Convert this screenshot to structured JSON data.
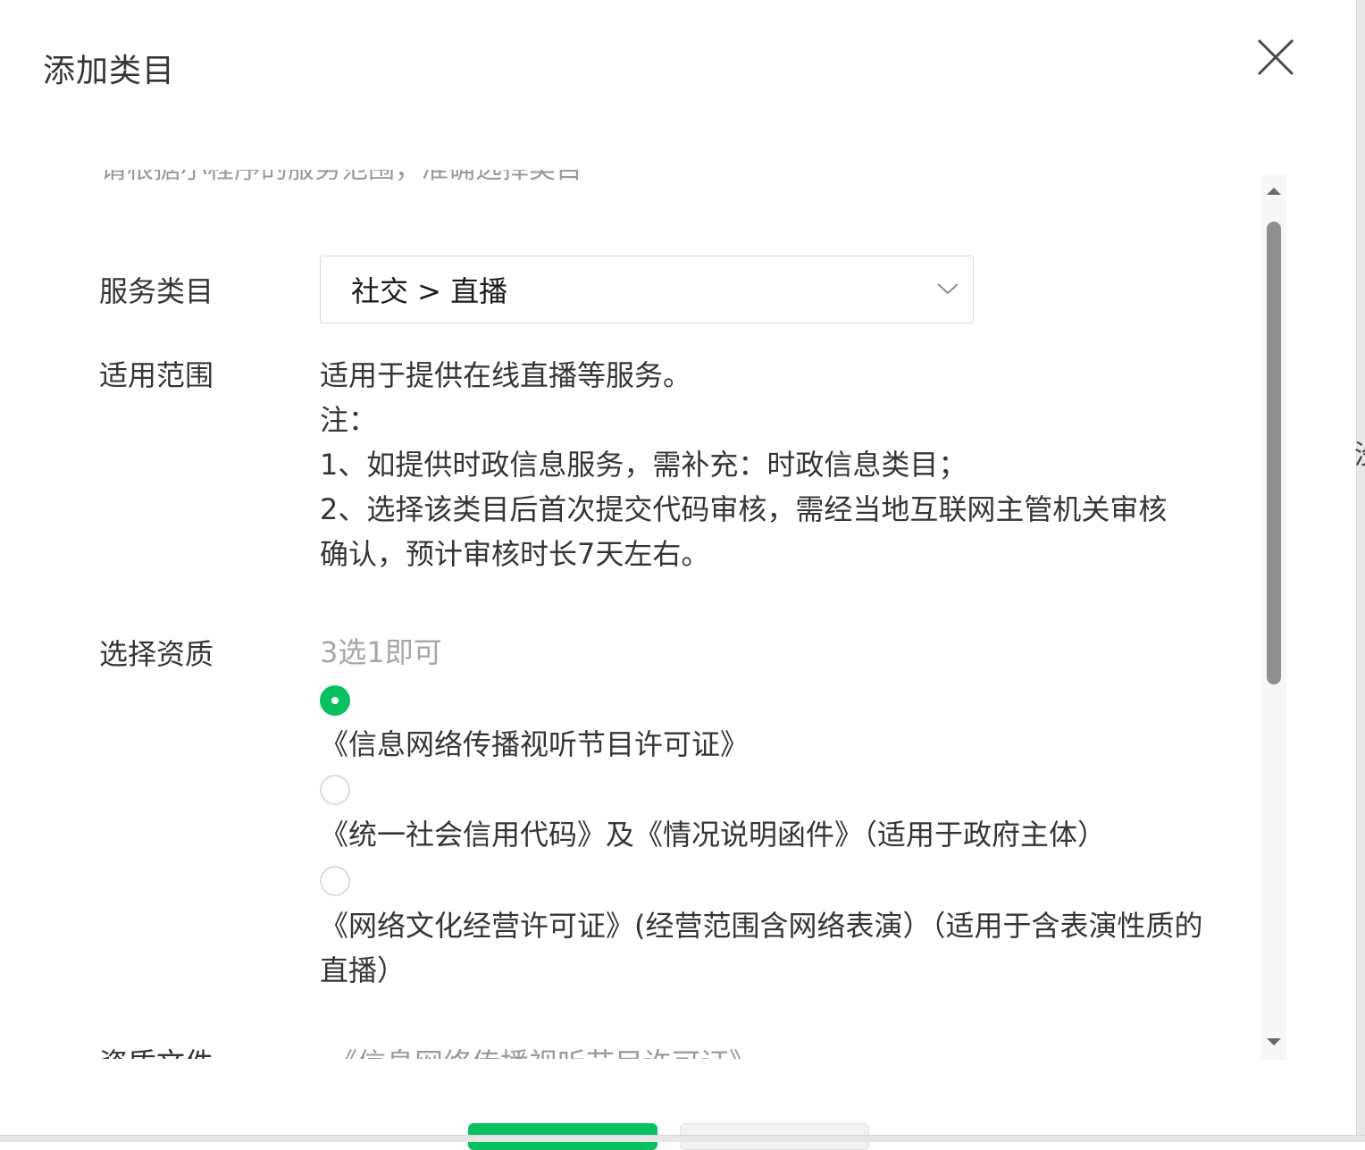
{
  "dialog": {
    "title": "添加类目",
    "hint_partial": "请根据小程序的服务范围，准确选择类目"
  },
  "form": {
    "service_category": {
      "label": "服务类目",
      "value": "社交 > 直播"
    },
    "scope": {
      "label": "适用范围",
      "lines": [
        "适用于提供在线直播等服务。",
        "注：",
        "1、如提供时政信息服务，需补充：时政信息类目；",
        "2、选择该类目后首次提交代码审核，需经当地互联网主管机关审核确认，预计审核时长7天左右。"
      ]
    },
    "qualification": {
      "label": "选择资质",
      "hint": "3选1即可",
      "options": [
        {
          "text": "《信息网络传播视听节目许可证》",
          "selected": true
        },
        {
          "text": "《统一社会信用代码》及《情况说明函件》（适用于政府主体）",
          "selected": false
        },
        {
          "text": "《网络文化经营许可证》(经营范围含网络表演）（适用于含表演性质的直播）",
          "selected": false
        }
      ]
    },
    "qualification_file": {
      "label": "资质文件",
      "value": "《信息网络传播视听节目许可证》"
    }
  },
  "background": {
    "edge_glyph": "没"
  },
  "colors": {
    "accent": "#07c160",
    "text": "#353535",
    "muted": "#a6a6a6",
    "border": "#d9d9d9"
  },
  "icons": {
    "close": "close-icon",
    "dropdown": "chevron-down-icon"
  }
}
